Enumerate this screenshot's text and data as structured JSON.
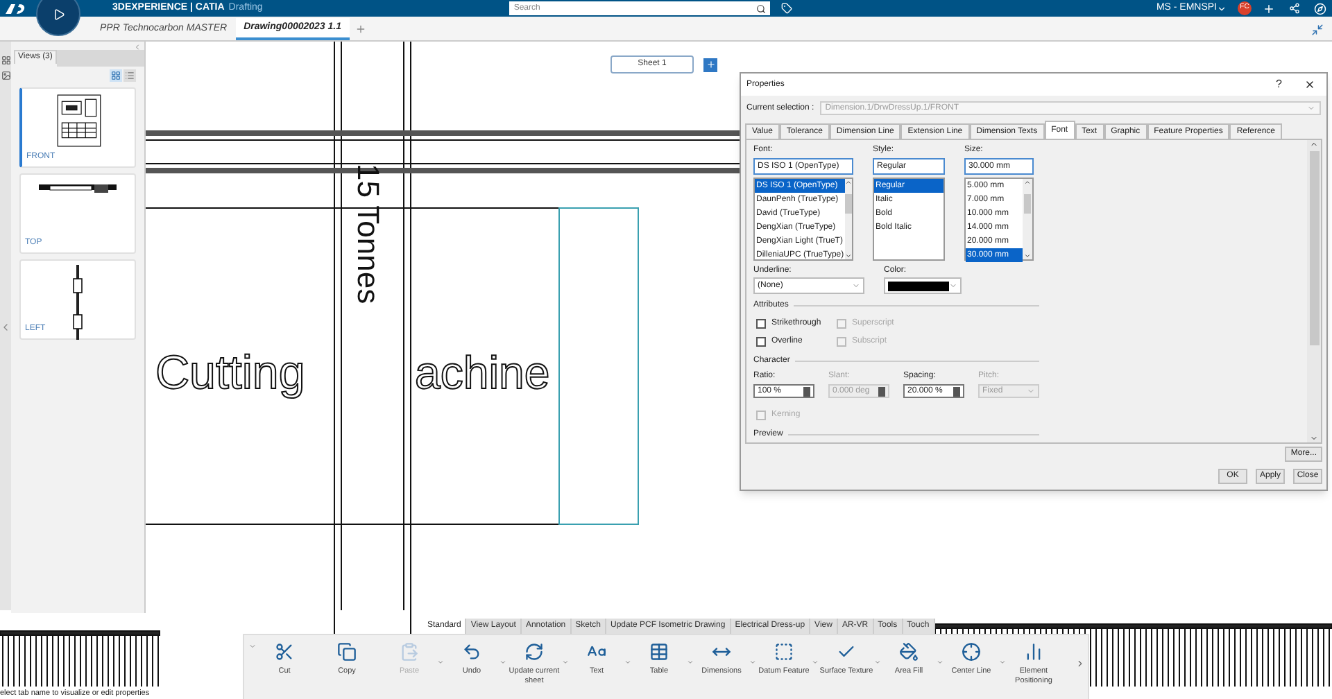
{
  "app_bar": {
    "brand": "3DEXPERIENCE | CATIA",
    "app": "Drafting",
    "search": {
      "placeholder": "Search"
    },
    "user": "MS - EMNSPI",
    "avatar": "FC"
  },
  "doc_tabs": [
    {
      "label": "PPR Technocarbon MASTER",
      "selected": false
    },
    {
      "label": "Drawing00002023 1.1",
      "selected": true
    }
  ],
  "views_panel": {
    "tab": "Views (3)",
    "layout_buttons": [
      {
        "kind": "grid",
        "selected": true
      },
      {
        "kind": "list",
        "selected": false
      }
    ],
    "views": [
      {
        "label": "FRONT",
        "kind": "front",
        "selected": true
      },
      {
        "label": "TOP",
        "kind": "top",
        "selected": false
      },
      {
        "label": "LEFT",
        "kind": "left",
        "selected": false
      }
    ]
  },
  "canvas": {
    "sheet_tabs": [
      {
        "label": "Sheet 1",
        "selected": true
      }
    ],
    "vertical_text": "15 Tonnes",
    "title_left": "Cutting",
    "title_right": "achine"
  },
  "properties": {
    "title": "Properties",
    "help": "?",
    "current_selection": {
      "label": "Current selection :",
      "value": "Dimension.1/DrwDressUp.1/FRONT"
    },
    "tabs": [
      {
        "label": "Value",
        "selected": false
      },
      {
        "label": "Tolerance",
        "selected": false
      },
      {
        "label": "Dimension Line",
        "selected": false
      },
      {
        "label": "Extension Line",
        "selected": false
      },
      {
        "label": "Dimension Texts",
        "selected": false
      },
      {
        "label": "Font",
        "selected": true
      },
      {
        "label": "Text",
        "selected": false
      },
      {
        "label": "Graphic",
        "selected": false
      },
      {
        "label": "Feature Properties",
        "selected": false
      },
      {
        "label": "Reference",
        "selected": false
      }
    ],
    "lists": [
      {
        "label": "Font:",
        "value": "DS ISO 1 (OpenType)",
        "options": [
          {
            "label": "DS ISO 1 (OpenType)",
            "selected": true
          },
          {
            "label": "DaunPenh (TrueType)",
            "selected": false
          },
          {
            "label": "David (TrueType)",
            "selected": false
          },
          {
            "label": "DengXian (TrueType)",
            "selected": false
          },
          {
            "label": "DengXian Light (TrueT)",
            "selected": false
          },
          {
            "label": "DilleniaUPC (TrueType)",
            "selected": false
          }
        ]
      },
      {
        "label": "Style:",
        "value": "Regular",
        "options": [
          {
            "label": "Regular",
            "selected": true
          },
          {
            "label": "Italic",
            "selected": false
          },
          {
            "label": "Bold",
            "selected": false
          },
          {
            "label": "Bold Italic",
            "selected": false
          }
        ]
      },
      {
        "label": "Size:",
        "value": "30.000 mm",
        "options": [
          {
            "label": "5.000 mm",
            "selected": false
          },
          {
            "label": "7.000 mm",
            "selected": false
          },
          {
            "label": "10.000 mm",
            "selected": false
          },
          {
            "label": "14.000 mm",
            "selected": false
          },
          {
            "label": "20.000 mm",
            "selected": false
          },
          {
            "label": "30.000 mm",
            "selected": true
          }
        ]
      }
    ],
    "underline": {
      "label": "Underline:",
      "value": "(None)"
    },
    "color": {
      "label": "Color:",
      "color": "#000000"
    },
    "attributes": {
      "title": "Attributes",
      "checkboxes": [
        {
          "label": "Strikethrough",
          "checked": false,
          "disabled": false
        },
        {
          "label": "Superscript",
          "checked": false,
          "disabled": true
        },
        {
          "label": "Overline",
          "checked": false,
          "disabled": false
        },
        {
          "label": "Subscript",
          "checked": false,
          "disabled": true
        }
      ]
    },
    "character": {
      "title": "Character",
      "fields": [
        {
          "label": "Ratio:",
          "value": "100 %",
          "kind": "spin",
          "disabled": false
        },
        {
          "label": "Slant:",
          "value": "0.000 deg",
          "kind": "spin",
          "disabled": true
        },
        {
          "label": "Spacing:",
          "value": "20.000 %",
          "kind": "spin",
          "disabled": false
        },
        {
          "label": "Pitch:",
          "value": "Fixed",
          "kind": "select",
          "disabled": true
        }
      ]
    },
    "kerning": {
      "label": "Kerning",
      "checked": false,
      "disabled": true
    },
    "preview_title": "Preview",
    "more_button": "More...",
    "buttons": [
      "OK",
      "Apply",
      "Close"
    ]
  },
  "toolbar": {
    "tabs": [
      {
        "label": "Standard",
        "selected": true
      },
      {
        "label": "View Layout",
        "selected": false
      },
      {
        "label": "Annotation",
        "selected": false
      },
      {
        "label": "Sketch",
        "selected": false
      },
      {
        "label": "Update PCF Isometric Drawing",
        "selected": false
      },
      {
        "label": "Electrical Dress-up",
        "selected": false
      },
      {
        "label": "View",
        "selected": false
      },
      {
        "label": "AR-VR",
        "selected": false
      },
      {
        "label": "Tools",
        "selected": false
      },
      {
        "label": "Touch",
        "selected": false
      }
    ],
    "buttons": [
      {
        "label": "Cut",
        "kind": "cut",
        "disabled": false,
        "menu": false
      },
      {
        "label": "Copy",
        "kind": "copy",
        "disabled": false,
        "menu": false
      },
      {
        "label": "Paste",
        "kind": "paste",
        "disabled": true,
        "menu": true
      },
      {
        "label": "Undo",
        "kind": "undo",
        "disabled": false,
        "menu": true
      },
      {
        "label": "Update current sheet",
        "kind": "update",
        "disabled": false,
        "menu": true
      },
      {
        "label": "Text",
        "kind": "text",
        "disabled": false,
        "menu": true
      },
      {
        "label": "Table",
        "kind": "table",
        "disabled": false,
        "menu": true
      },
      {
        "label": "Dimensions",
        "kind": "dimensions",
        "disabled": false,
        "menu": true
      },
      {
        "label": "Datum Feature",
        "kind": "datum",
        "disabled": false,
        "menu": true
      },
      {
        "label": "Surface Texture",
        "kind": "surface",
        "disabled": false,
        "menu": true
      },
      {
        "label": "Area Fill",
        "kind": "fill",
        "disabled": false,
        "menu": true
      },
      {
        "label": "Center Line",
        "kind": "center",
        "disabled": false,
        "menu": true
      },
      {
        "label": "Element Positioning",
        "kind": "position",
        "disabled": false,
        "menu": false
      }
    ]
  },
  "status_bar": "elect tab name to visualize or edit properties"
}
